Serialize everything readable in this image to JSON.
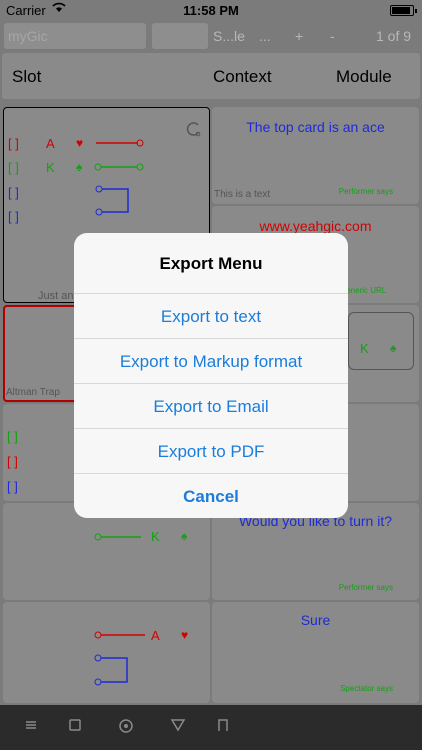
{
  "status": {
    "carrier": "Carrier",
    "time": "11:58 PM",
    "battery_level": 0.9
  },
  "toolbar": {
    "name_value": "myGic",
    "select_label": "S...le",
    "ellipsis": "...",
    "plus": "+",
    "minus": "-",
    "position": "1 of 9"
  },
  "segments": {
    "slot": "Slot",
    "context": "Context",
    "module": "Module"
  },
  "cards": {
    "c1": {
      "rows": [
        {
          "bracket": "[ ]",
          "rank": "A",
          "suit": "♥",
          "color": "#d40000"
        },
        {
          "bracket": "[ ]",
          "rank": "K",
          "suit": "♠",
          "color": "#13a113"
        },
        {
          "bracket": "[ ]",
          "color": "#1e2bd6"
        },
        {
          "bracket": "[ ]",
          "color": "#1e2bd6"
        }
      ],
      "caption": "Just an"
    },
    "c2": {
      "text": "The top card is an ace",
      "subtext": "This is a text",
      "tag": "Performer says"
    },
    "c3": {
      "text": "www.yeahgic.com",
      "tag": "Generic URL"
    },
    "c4": {
      "caption": "Altman Trap"
    },
    "c5": {
      "rank": "K",
      "suit": "♠"
    },
    "c6": {
      "rows": [
        "[ ]",
        "[ ]",
        "[ ]"
      ]
    },
    "c7": {
      "text": "Would you like to turn it?",
      "tag": "Performer says"
    },
    "c8": {
      "rank": "K",
      "suit": "♠"
    },
    "c9": {
      "rank": "A",
      "suit": "♥"
    },
    "c10": {
      "text": "Sure",
      "tag": "Spectator says"
    }
  },
  "dialog": {
    "title": "Export Menu",
    "items": [
      "Export to text",
      "Export to Markup format",
      "Export to Email",
      "Export to PDF"
    ],
    "cancel": "Cancel"
  },
  "bottombar": {
    "icons": [
      "menu-icon",
      "square-icon",
      "circle-icon",
      "triangle-icon",
      "bracket-icon"
    ]
  },
  "colors": {
    "red": "#d40000",
    "green": "#13a113",
    "blue": "#1e2bd6",
    "accent": "#1a7ddb"
  }
}
